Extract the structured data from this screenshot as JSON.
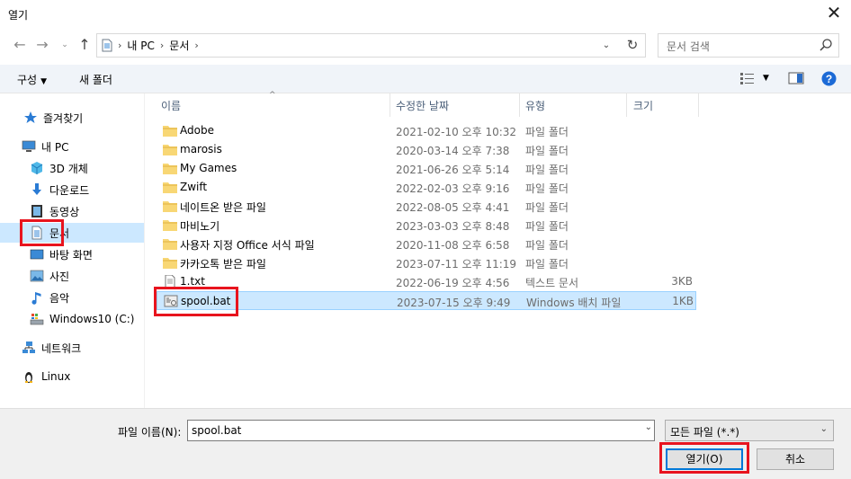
{
  "window": {
    "title": "열기"
  },
  "navbar": {
    "breadcrumb": [
      "내 PC",
      "문서"
    ],
    "search_placeholder": "문서 검색"
  },
  "toolbar": {
    "organize": "구성",
    "new_folder": "새 폴더"
  },
  "sidebar": {
    "items": [
      {
        "label": "즐겨찾기",
        "icon": "star-icon"
      },
      {
        "label": "내 PC",
        "icon": "computer-icon"
      },
      {
        "label": "3D 개체",
        "icon": "cube-icon"
      },
      {
        "label": "다운로드",
        "icon": "download-icon"
      },
      {
        "label": "동영상",
        "icon": "video-icon"
      },
      {
        "label": "문서",
        "icon": "document-icon"
      },
      {
        "label": "바탕 화면",
        "icon": "desktop-icon"
      },
      {
        "label": "사진",
        "icon": "pictures-icon"
      },
      {
        "label": "음악",
        "icon": "music-icon"
      },
      {
        "label": "Windows10 (C:)",
        "icon": "drive-icon"
      },
      {
        "label": "네트워크",
        "icon": "network-icon"
      },
      {
        "label": "Linux",
        "icon": "linux-icon"
      }
    ]
  },
  "columns": {
    "name": "이름",
    "date": "수정한 날짜",
    "type": "유형",
    "size": "크기"
  },
  "files": [
    {
      "name": "Adobe",
      "date": "2021-02-10 오후 10:32",
      "type": "파일 폴더",
      "size": "",
      "icon": "folder-icon"
    },
    {
      "name": "marosis",
      "date": "2020-03-14 오후 7:38",
      "type": "파일 폴더",
      "size": "",
      "icon": "folder-icon"
    },
    {
      "name": "My Games",
      "date": "2021-06-26 오후 5:14",
      "type": "파일 폴더",
      "size": "",
      "icon": "folder-icon"
    },
    {
      "name": "Zwift",
      "date": "2022-02-03 오후 9:16",
      "type": "파일 폴더",
      "size": "",
      "icon": "folder-icon"
    },
    {
      "name": "네이트온 받은 파일",
      "date": "2022-08-05 오후 4:41",
      "type": "파일 폴더",
      "size": "",
      "icon": "folder-icon"
    },
    {
      "name": "마비노기",
      "date": "2023-03-03 오후 8:48",
      "type": "파일 폴더",
      "size": "",
      "icon": "folder-icon"
    },
    {
      "name": "사용자 지정 Office 서식 파일",
      "date": "2020-11-08 오후 6:58",
      "type": "파일 폴더",
      "size": "",
      "icon": "folder-icon"
    },
    {
      "name": "카카오톡 받은 파일",
      "date": "2023-07-11 오후 11:19",
      "type": "파일 폴더",
      "size": "",
      "icon": "folder-icon"
    },
    {
      "name": "1.txt",
      "date": "2022-06-19 오후 4:56",
      "type": "텍스트 문서",
      "size": "3KB",
      "icon": "text-file-icon"
    },
    {
      "name": "spool.bat",
      "date": "2023-07-15 오후 9:49",
      "type": "Windows 배치 파일",
      "size": "1KB",
      "icon": "batch-file-icon",
      "selected": true
    }
  ],
  "bottom": {
    "filename_label": "파일 이름(N):",
    "filename_value": "spool.bat",
    "filetype_value": "모든 파일 (*.*)",
    "open_button": "열기(O)",
    "cancel_button": "취소"
  },
  "colors": {
    "selection": "#cce8ff",
    "accent": "#0078d7",
    "highlight_box": "#e8141e",
    "folder": "#f8d775"
  }
}
